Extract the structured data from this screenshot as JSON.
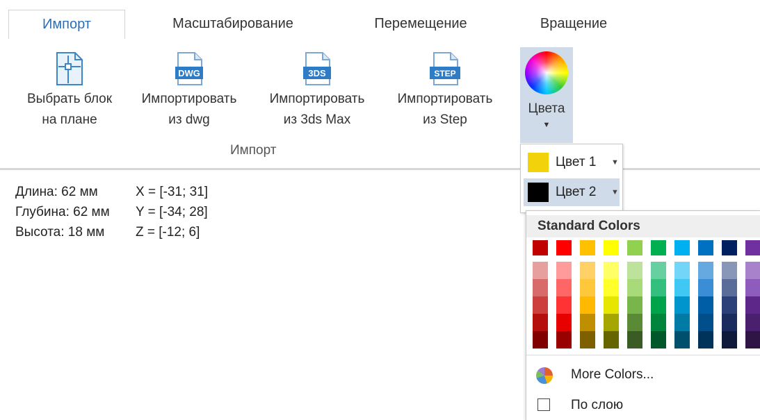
{
  "tabs": [
    "Импорт",
    "Масштабирование",
    "Перемещение",
    "Вращение"
  ],
  "ribbon": {
    "buttons": [
      {
        "line1": "Выбрать блок",
        "line2": "на плане",
        "icon": "block-plan-icon"
      },
      {
        "line1": "Импортировать",
        "line2": "из dwg",
        "icon": "dwg-file-icon",
        "badge": "DWG"
      },
      {
        "line1": "Импортировать",
        "line2": "из 3ds Max",
        "icon": "3ds-file-icon",
        "badge": "3DS"
      },
      {
        "line1": "Импортировать",
        "line2": "из Step",
        "icon": "step-file-icon",
        "badge": "STEP"
      }
    ],
    "group_label": "Импорт",
    "colors_label": "Цвета"
  },
  "info": {
    "rows": [
      {
        "label": "Длина: 62 мм",
        "range": "X = [-31; 31]"
      },
      {
        "label": "Глубина: 62 мм",
        "range": "Y = [-34; 28]"
      },
      {
        "label": "Высота: 18 мм",
        "range": "Z = [-12; 6]"
      }
    ]
  },
  "submenu": {
    "items": [
      {
        "label": "Цвет 1",
        "color": "#f2d20a"
      },
      {
        "label": "Цвет 2",
        "color": "#000000"
      }
    ]
  },
  "palette": {
    "header": "Standard Colors",
    "standard": [
      "#c00000",
      "#ff0000",
      "#ffc000",
      "#ffff00",
      "#92d050",
      "#00b050",
      "#00b0f0",
      "#0070c0",
      "#002060",
      "#7030a0"
    ],
    "columns": [
      [
        "#e6a09e",
        "#d86b69",
        "#cc3f3c",
        "#b40f0c",
        "#800000"
      ],
      [
        "#ff9b9b",
        "#ff6666",
        "#ff3333",
        "#e60000",
        "#990000"
      ],
      [
        "#ffd166",
        "#ffc73a",
        "#ffb900",
        "#bf8f00",
        "#7f6000"
      ],
      [
        "#ffff66",
        "#ffff2a",
        "#e6e600",
        "#a6a600",
        "#666600"
      ],
      [
        "#bde29b",
        "#a8da79",
        "#78b54a",
        "#5a8a36",
        "#3b5b24"
      ],
      [
        "#66d0a0",
        "#33c07f",
        "#00a24a",
        "#00853c",
        "#00582a"
      ],
      [
        "#73d6f8",
        "#40c8f5",
        "#0095cc",
        "#007ba6",
        "#00506d"
      ],
      [
        "#66a8e0",
        "#3a8ed6",
        "#005ea6",
        "#004f8a",
        "#00335a"
      ],
      [
        "#8896b8",
        "#5a6c98",
        "#2b3f78",
        "#1a2c5e",
        "#0f1a3a"
      ],
      [
        "#a982cc",
        "#8d5cbd",
        "#5c2788",
        "#4a1f6d",
        "#2f1446"
      ]
    ],
    "more_colors": "More Colors...",
    "by_layer": "По слою"
  }
}
